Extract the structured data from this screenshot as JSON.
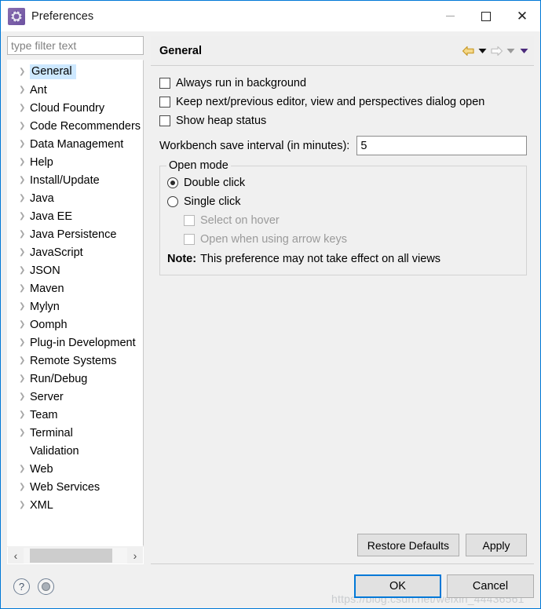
{
  "window": {
    "title": "Preferences",
    "icon": "preferences-gear-icon",
    "minimize_label": "Minimize",
    "maximize_label": "Maximize",
    "close_label": "Close"
  },
  "sidebar": {
    "filter_placeholder": "type filter text",
    "filter_value": "",
    "selected": "General",
    "items": [
      {
        "label": "General",
        "expandable": true,
        "selected": true
      },
      {
        "label": "Ant",
        "expandable": true,
        "selected": false
      },
      {
        "label": "Cloud Foundry",
        "expandable": true,
        "selected": false
      },
      {
        "label": "Code Recommenders",
        "expandable": true,
        "selected": false
      },
      {
        "label": "Data Management",
        "expandable": true,
        "selected": false
      },
      {
        "label": "Help",
        "expandable": true,
        "selected": false
      },
      {
        "label": "Install/Update",
        "expandable": true,
        "selected": false
      },
      {
        "label": "Java",
        "expandable": true,
        "selected": false
      },
      {
        "label": "Java EE",
        "expandable": true,
        "selected": false
      },
      {
        "label": "Java Persistence",
        "expandable": true,
        "selected": false
      },
      {
        "label": "JavaScript",
        "expandable": true,
        "selected": false
      },
      {
        "label": "JSON",
        "expandable": true,
        "selected": false
      },
      {
        "label": "Maven",
        "expandable": true,
        "selected": false
      },
      {
        "label": "Mylyn",
        "expandable": true,
        "selected": false
      },
      {
        "label": "Oomph",
        "expandable": true,
        "selected": false
      },
      {
        "label": "Plug-in Development",
        "expandable": true,
        "selected": false
      },
      {
        "label": "Remote Systems",
        "expandable": true,
        "selected": false
      },
      {
        "label": "Run/Debug",
        "expandable": true,
        "selected": false
      },
      {
        "label": "Server",
        "expandable": true,
        "selected": false
      },
      {
        "label": "Team",
        "expandable": true,
        "selected": false
      },
      {
        "label": "Terminal",
        "expandable": true,
        "selected": false
      },
      {
        "label": "Validation",
        "expandable": false,
        "selected": false
      },
      {
        "label": "Web",
        "expandable": true,
        "selected": false
      },
      {
        "label": "Web Services",
        "expandable": true,
        "selected": false
      },
      {
        "label": "XML",
        "expandable": true,
        "selected": false
      }
    ],
    "scroll_left_label": "‹",
    "scroll_right_label": "›"
  },
  "page": {
    "title": "General",
    "nav": {
      "back_icon": "back-arrow-icon",
      "back_menu_icon": "back-history-dropdown-icon",
      "forward_icon": "forward-arrow-icon",
      "forward_menu_icon": "forward-history-dropdown-icon",
      "view_menu_icon": "view-menu-dropdown-icon"
    },
    "checkboxes": [
      {
        "label": "Always run in background",
        "checked": false,
        "enabled": true
      },
      {
        "label": "Keep next/previous editor, view and perspectives dialog open",
        "checked": false,
        "enabled": true
      },
      {
        "label": "Show heap status",
        "checked": false,
        "enabled": true
      }
    ],
    "save_interval": {
      "label": "Workbench save interval (in minutes):",
      "value": "5"
    },
    "open_mode": {
      "group_title": "Open mode",
      "radios": [
        {
          "label": "Double click",
          "selected": true
        },
        {
          "label": "Single click",
          "selected": false
        }
      ],
      "sub_checkboxes": [
        {
          "label": "Select on hover",
          "checked": false,
          "enabled": false
        },
        {
          "label": "Open when using arrow keys",
          "checked": false,
          "enabled": false
        }
      ],
      "note_prefix": "Note:",
      "note_text": "This preference may not take effect on all views"
    },
    "restore_defaults_label": "Restore Defaults",
    "apply_label": "Apply"
  },
  "footer": {
    "help_icon": "help-question-icon",
    "help_glyph": "?",
    "secondary_icon": "apply-and-close-hint-icon",
    "ok_label": "OK",
    "cancel_label": "Cancel",
    "watermark": "https://blog.csdn.net/weixin_44436561"
  },
  "colors": {
    "accent": "#0078d7",
    "selection": "#cde8ff",
    "dialog_bg": "#f0f0f0",
    "back_arrow": "#e8b33a",
    "forward_arrow": "#bdbdbd",
    "view_menu": "#5a2d8c"
  }
}
